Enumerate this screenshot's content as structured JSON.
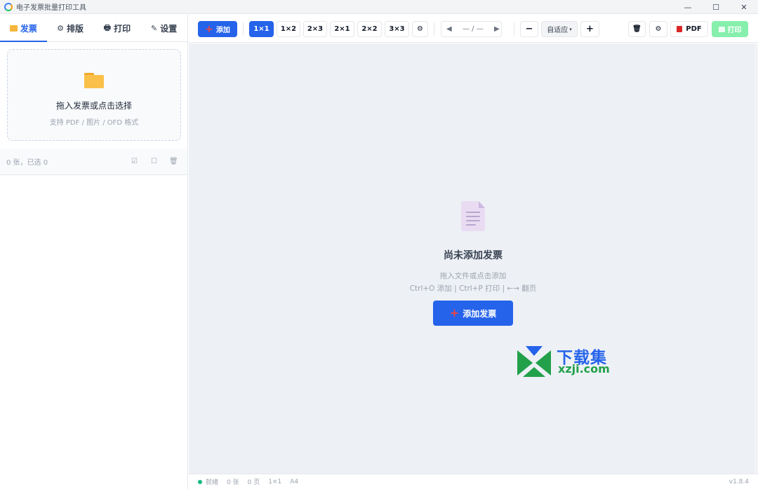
{
  "window": {
    "title": "电子发票批量打印工具",
    "controls": [
      "—",
      "☐",
      "✕"
    ]
  },
  "sidebar": {
    "tabs": [
      {
        "label": "发票",
        "icon": "folder-icon",
        "active": true
      },
      {
        "label": "排版",
        "icon": "gear-icon",
        "active": false
      },
      {
        "label": "打印",
        "icon": "printer-icon",
        "active": false
      },
      {
        "label": "设置",
        "icon": "wrench-icon",
        "active": false
      }
    ],
    "tab_glyphs": [
      "⚙",
      "🖶",
      "✎"
    ],
    "dropzone": {
      "title": "拖入发票或点击选择",
      "subtitle": "支持 PDF / 图片 / OFD 格式"
    },
    "list": {
      "count_text": "0 张，已选 0",
      "icons": [
        "☑",
        "☐",
        "🗑"
      ]
    }
  },
  "toolbar": {
    "add_label": "添加",
    "layouts": [
      "1×1",
      "1×2",
      "2×3",
      "2×1",
      "2×2",
      "3×3"
    ],
    "active_layout": "1×1",
    "layout_settings_icon": "⚙",
    "prev_icon": "◀",
    "page_indicator": "— / —",
    "next_icon": "▶",
    "zoom_out": "−",
    "zoom_value": "自适应",
    "zoom_in": "+",
    "clear_icon": "🗑",
    "settings_icon": "⚙",
    "pdf_label": "PDF",
    "print_label": "打印"
  },
  "main": {
    "empty_title": "尚未添加发票",
    "empty_line1": "拖入文件或点击添加",
    "empty_line2": "Ctrl+O 添加 | Ctrl+P 打印 | ←→ 翻页",
    "add_button": "添加发票"
  },
  "watermark": {
    "line1": "下载集",
    "line2": "xzji.com"
  },
  "statusbar": {
    "status": "就绪",
    "count": "0 张",
    "pages": "0 页",
    "layout": "1×1",
    "paper": "A4",
    "version": "v1.8.4"
  },
  "colors": {
    "accent": "#2563eb",
    "print_disabled": "#86efac",
    "status_ok": "#10b981"
  }
}
